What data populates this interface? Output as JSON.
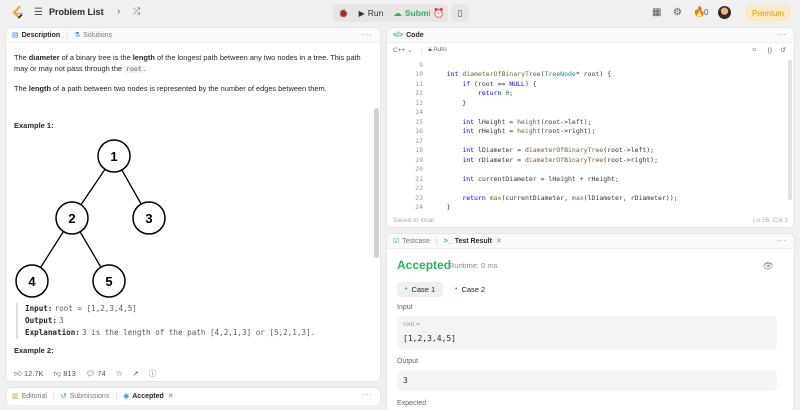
{
  "topbar": {
    "problem_list_label": "Problem List",
    "run_label": "Run",
    "submit_label": "Submit",
    "premium_label": "Premium",
    "fire_count": "0"
  },
  "description_panel": {
    "tabs": [
      {
        "label": "Description"
      },
      {
        "label": "Solutions"
      }
    ],
    "para1": {
      "t1": "The ",
      "b1": "diameter",
      "t2": " of a binary tree is the ",
      "b2": "length",
      "t3": " of the longest path between any two nodes in a tree. This path may or may not pass through the ",
      "code": "root",
      "t4": "."
    },
    "para2": {
      "t1": "The ",
      "b1": "length",
      "t2": " of a path between two nodes is represented by the number of edges between them."
    },
    "example1_title": "Example 1:",
    "example2_title": "Example 2:",
    "tree_nodes": [
      "1",
      "2",
      "3",
      "4",
      "5"
    ],
    "example1": {
      "input_label": "Input:",
      "input_value": "root = [1,2,3,4,5]",
      "output_label": "Output:",
      "output_value": "3",
      "explanation_label": "Explanation:",
      "explanation_value": "3 is the length of the path [4,2,1,3] or [5,2,1,3]."
    },
    "stats": {
      "likes": "12.7K",
      "dislikes": "813",
      "comments": "74"
    }
  },
  "bottom_left_tabs": [
    {
      "label": "Editorial"
    },
    {
      "label": "Submissions"
    },
    {
      "label": "Accepted"
    }
  ],
  "code_panel": {
    "tab_label": "Code",
    "language": "C++",
    "mode": "Auto",
    "line_numbers": [
      "9",
      "10",
      "11",
      "12",
      "13",
      "14",
      "15",
      "16",
      "17",
      "18",
      "19",
      "20",
      "21",
      "22",
      "23",
      "24"
    ],
    "saved_label": "Saved to local",
    "cursor_pos": "Ln 26, Col 1"
  },
  "test_panel": {
    "tabs": [
      {
        "label": "Testcase"
      },
      {
        "label": "Test Result"
      }
    ],
    "verdict": "Accepted",
    "runtime": "Runtime: 0 ms",
    "cases": [
      {
        "label": "Case 1"
      },
      {
        "label": "Case 2"
      }
    ],
    "input_label": "Input",
    "param_name": "root =",
    "input_value": "[1,2,3,4,5]",
    "output_label": "Output",
    "output_value": "3",
    "expected_label": "Expected"
  },
  "colors": {
    "accent_green": "#2db55d",
    "premium_orange": "#e6920a"
  }
}
